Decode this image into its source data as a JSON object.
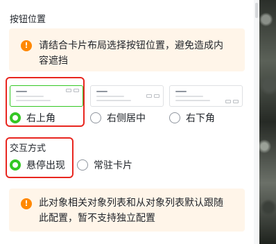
{
  "button_position": {
    "section_title": "按钮位置",
    "notice_icon": "warning-circle-icon",
    "notice_line1": "请结合卡片布局选择按钮位置，避免造成内",
    "notice_line2": "容遮挡",
    "options": [
      {
        "label": "右上角",
        "selected": true
      },
      {
        "label": "右侧居中",
        "selected": false
      },
      {
        "label": "右下角",
        "selected": false
      }
    ]
  },
  "interaction_mode": {
    "section_title": "交互方式",
    "options": [
      {
        "label": "悬停出现",
        "selected": true
      },
      {
        "label": "常驻卡片",
        "selected": false
      }
    ]
  },
  "bottom_notice": {
    "icon": "warning-circle-icon",
    "line1": "此对象相关对象列表和从对象列表默认跟随",
    "line2": "此配置，暂不支持独立配置"
  },
  "colors": {
    "accent": "#34c724",
    "warning": "#ff8800",
    "notice_bg": "#fff5e9",
    "highlight": "#e8261f"
  }
}
